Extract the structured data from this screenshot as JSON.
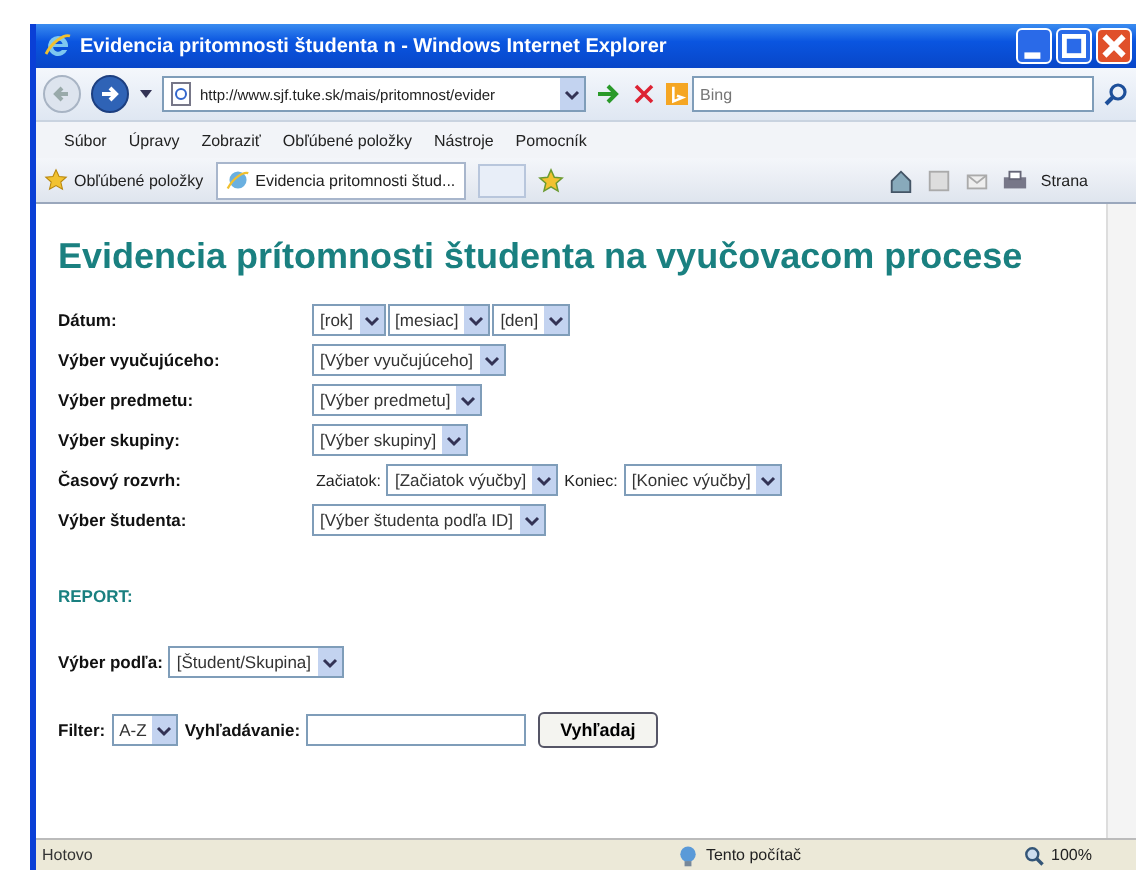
{
  "window": {
    "title": "Evidencia pritomnosti študenta n - Windows Internet Explorer"
  },
  "address_bar": {
    "url": "http://www.sjf.tuke.sk/mais/pritomnost/evider",
    "search_placeholder": "Bing"
  },
  "menu": [
    "Súbor",
    "Úpravy",
    "Zobraziť",
    "Obľúbené položky",
    "Nástroje",
    "Pomocník"
  ],
  "favorites_bar": {
    "favorites": "Obľúbené položky",
    "tab": "Evidencia pritomnosti štud...",
    "page_menu": "Strana"
  },
  "page": {
    "heading": "Evidencia prítomnosti študenta na vyučovacom procese",
    "rows": [
      {
        "label": "Dátum:",
        "fields": [
          {
            "value": "[rok]"
          },
          {
            "value": "[mesiac]"
          },
          {
            "value": "[den]"
          }
        ]
      },
      {
        "label": "Výber vyučujúceho:",
        "fields": [
          {
            "value": "[Výber vyučujúceho]"
          }
        ]
      },
      {
        "label": "Výber predmetu:",
        "fields": [
          {
            "value": "[Výber predmetu]"
          }
        ]
      },
      {
        "label": "Výber skupiny:",
        "fields": [
          {
            "value": "[Výber skupiny]"
          }
        ]
      },
      {
        "label": "Časový rozvrh:",
        "fields": [
          {
            "label": "Začiatok:",
            "value": "[Začiatok výučby]"
          },
          {
            "label": "Koniec:",
            "value": "[Koniec výučby]"
          }
        ]
      },
      {
        "label": "Výber študenta:",
        "fields": [
          {
            "value": "[Výber študenta podľa ID]"
          }
        ]
      }
    ],
    "report": "REPORT:",
    "select_by": {
      "label": "Výber podľa:",
      "value": "[Študent/Skupina]"
    },
    "filter": {
      "label": "Filter:",
      "value": "A-Z",
      "search_label": "Vyhľadávanie:",
      "button": "Vyhľadaj"
    }
  },
  "status_bar": {
    "status": "Hotovo",
    "zone": "Tento počítač",
    "zoom": "100%"
  }
}
